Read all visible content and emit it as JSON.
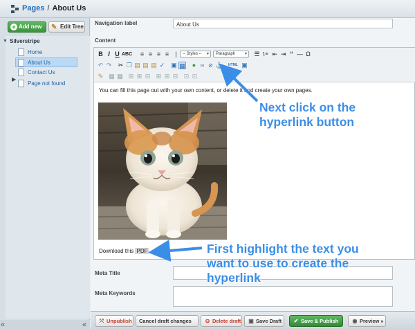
{
  "header": {
    "section_link": "Pages",
    "separator": "/",
    "current_page": "About Us"
  },
  "sidebar": {
    "add_new_label": "Add new",
    "edit_tree_label": "Edit Tree",
    "tree_root": "Silverstripe",
    "tree_items": [
      {
        "label": "Home",
        "selected": false
      },
      {
        "label": "About Us",
        "selected": true
      },
      {
        "label": "Contact Us",
        "selected": false
      },
      {
        "label": "Page not found",
        "selected": false
      }
    ],
    "collapse_left": "«",
    "collapse_right": "«"
  },
  "form": {
    "navigation_label": "Navigation label",
    "navigation_value": "About Us",
    "content_label": "Content",
    "meta_title_label": "Meta Title",
    "meta_title_value": "",
    "meta_keywords_label": "Meta Keywords",
    "meta_keywords_value": ""
  },
  "editor": {
    "styles_select": "-- Styles --",
    "format_select": "Paragraph",
    "html_button": "HTML",
    "body_text": "You can fill this page out with your own content, or delete it and create your own pages.",
    "download_prefix": "Download this ",
    "download_link_text": "PDF",
    "download_suffix": "."
  },
  "actions": {
    "unpublish": "Unpublish",
    "cancel_draft": "Cancel draft changes",
    "delete_draft": "Delete draft",
    "save_draft": "Save Draft",
    "save_publish": "Save & Publish",
    "preview": "Preview »"
  },
  "annotations": {
    "hyperlink_callout_line1": "Next click on the",
    "hyperlink_callout_line2": "hyperlink button",
    "highlight_callout_line1": "First highlight the text you",
    "highlight_callout_line2": "want to use to create the",
    "highlight_callout_line3": "hyperlink"
  },
  "colors": {
    "annotation_blue": "#3b8ee6",
    "publish_green": "#3a923a",
    "unpublish_red": "#c0392b",
    "link_blue": "#1d6fb8"
  }
}
